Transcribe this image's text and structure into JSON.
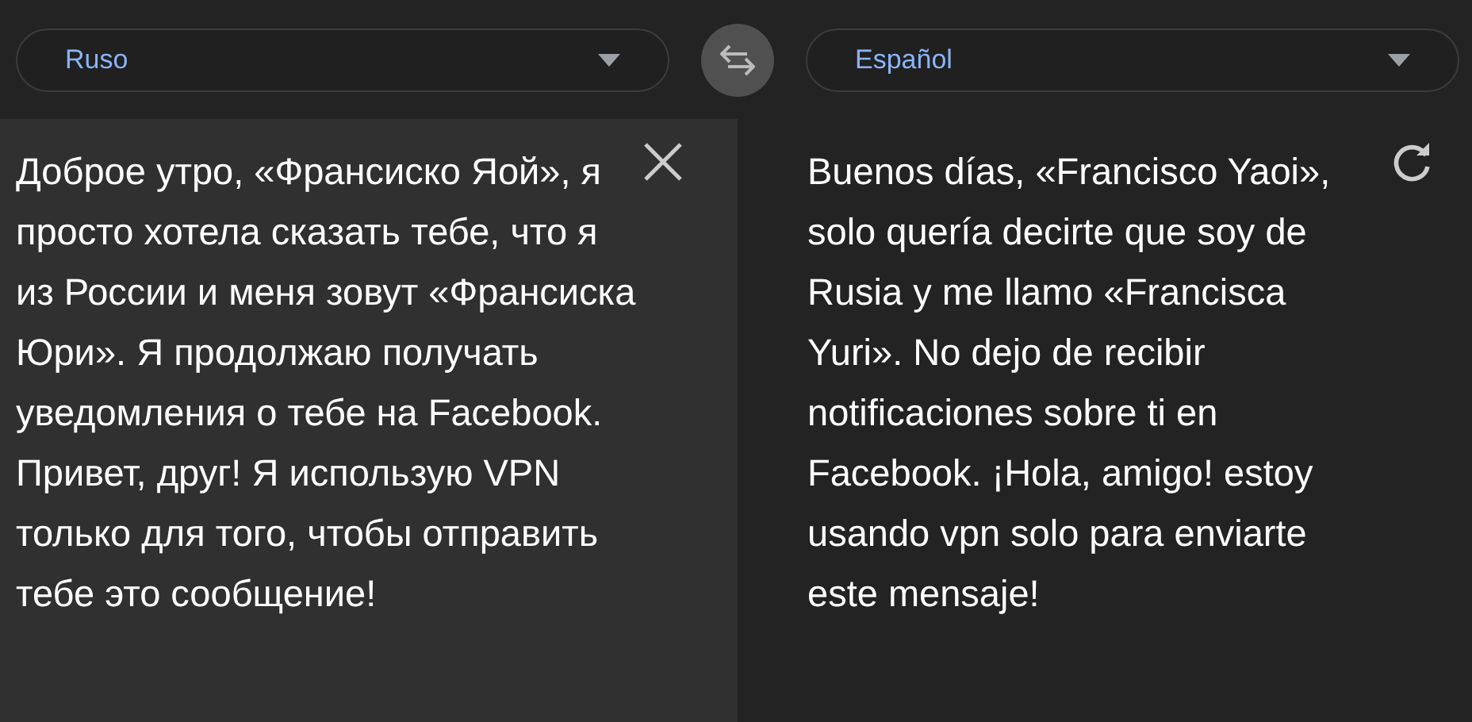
{
  "source_language": {
    "label": "Ruso"
  },
  "target_language": {
    "label": "Español"
  },
  "source_text": "Доброе утро, «Франсиско Яой», я просто хотела сказать тебе, что я из России и меня зовут «Франсиска Юри». Я продолжаю получать уведомления о тебе на Facebook. Привет, друг! Я использую VPN только для того, чтобы отправить тебе это сообщение!",
  "translated_text": "Buenos días, «Francisco Yaoi», solo quería decirte que soy de Rusia y me llamo «Francisca Yuri». No dejo de recibir notificaciones sobre ti en Facebook. ¡Hola, amigo! estoy usando vpn solo para enviarte este mensaje!"
}
